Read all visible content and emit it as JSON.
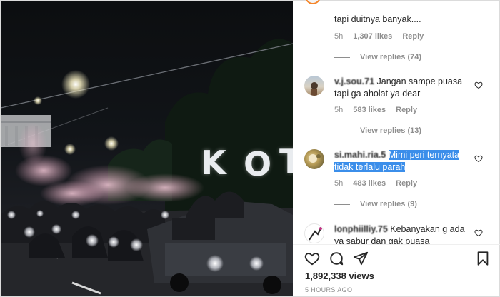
{
  "media": {
    "sign_letters": [
      "K",
      "O",
      "T"
    ]
  },
  "comments": [
    {
      "user": "",
      "text": "tapi duitnya banyak....",
      "time": "5h",
      "likes": "1,307 likes",
      "reply": "Reply",
      "view_replies": "View replies (74)"
    },
    {
      "user": "v.j.sou.71",
      "text": "Jangan sampe puasa tapi ga aholat ya dear",
      "time": "5h",
      "likes": "583 likes",
      "reply": "Reply",
      "view_replies": "View replies (13)"
    },
    {
      "user": "si.mahi.ria.5",
      "text": "Mimi peri ternyata tidak terlalu parah",
      "time": "5h",
      "likes": "483 likes",
      "reply": "Reply",
      "view_replies": "View replies (9)"
    },
    {
      "user": "lonphiilliy.75",
      "text": "Kebanyakan g ada ya sabur dan gak puasa",
      "time": "",
      "likes": "",
      "reply": "",
      "view_replies": ""
    }
  ],
  "footer": {
    "views": "1,892,338 views",
    "posted": "5 HOURS AGO"
  },
  "icons": {
    "like": "heart-icon",
    "comment": "comment-bubble-icon",
    "share": "paper-plane-icon",
    "save": "bookmark-icon"
  },
  "colors": {
    "highlight": "#3b8eea",
    "muted": "#8e8e8e",
    "text": "#262626",
    "story_ring": "#f58529"
  }
}
